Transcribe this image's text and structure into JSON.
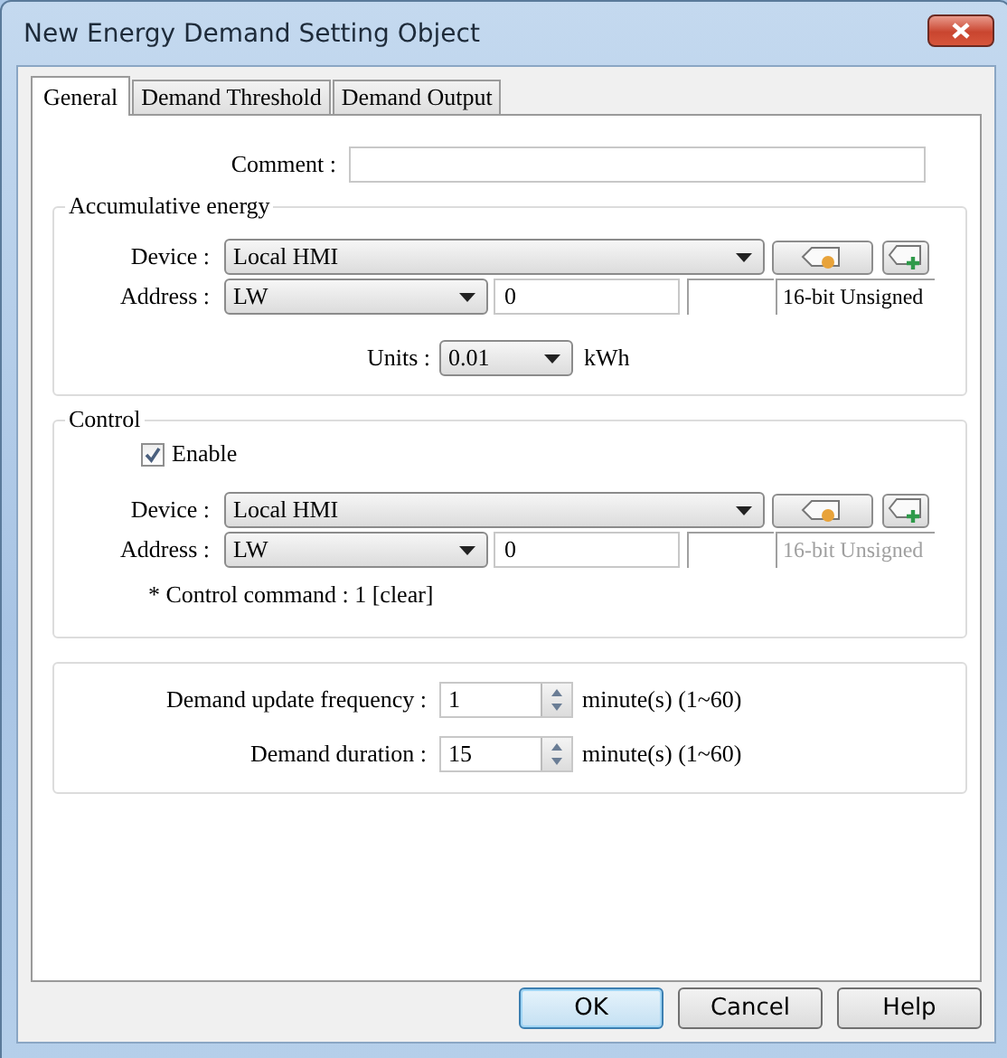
{
  "window": {
    "title": "New Energy Demand Setting Object"
  },
  "tabs": [
    {
      "label": "General",
      "selected": true
    },
    {
      "label": "Demand Threshold",
      "selected": false
    },
    {
      "label": "Demand Output",
      "selected": false
    }
  ],
  "comment": {
    "label": "Comment :"
  },
  "groups": [
    {
      "kind": "address",
      "title": "Accumulative energy",
      "device_label": "Device :",
      "device": "Local HMI",
      "address_label": "Address :",
      "address_type": "LW",
      "address": "0",
      "data_type": "16-bit Unsigned",
      "data_type_disabled": false,
      "units_label": "Units :",
      "units": "0.01",
      "units_suffix": "kWh"
    },
    {
      "kind": "address",
      "title": "Control",
      "enable": {
        "label": "Enable",
        "checked": true
      },
      "device_label": "Device :",
      "device": "Local HMI",
      "address_label": "Address :",
      "address_type": "LW",
      "address": "0",
      "data_type": "16-bit Unsigned",
      "data_type_disabled": true,
      "note": "* Control command : 1 [clear]"
    },
    {
      "kind": "spins",
      "rows": [
        {
          "label": "Demand update frequency :",
          "value": "1",
          "suffix": "minute(s) (1~60)"
        },
        {
          "label": "Demand duration :",
          "value": "15",
          "suffix": "minute(s) (1~60)"
        }
      ]
    }
  ],
  "buttons": [
    {
      "label": "OK",
      "default": true
    },
    {
      "label": "Cancel",
      "default": false
    },
    {
      "label": "Help",
      "default": false
    }
  ]
}
